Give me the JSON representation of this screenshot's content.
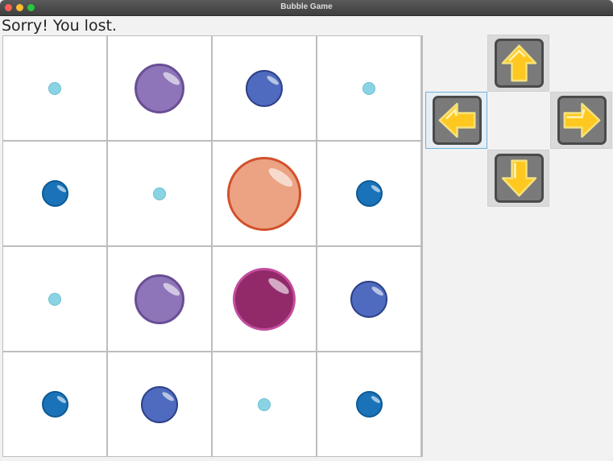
{
  "window": {
    "title": "Bubble Game"
  },
  "status": {
    "message": "Sorry! You lost."
  },
  "colors": {
    "light_blue": "#8ad3e3",
    "blue": "#1a73b8",
    "indigo": "#4f6bbf",
    "purple": "#8e74b8",
    "salmon": "#eba384",
    "magenta": "#922a6a",
    "arrow_yellow": "#ffc820"
  },
  "board": {
    "rows": 4,
    "cols": 4,
    "cells": [
      [
        {
          "color": "light_blue",
          "size": "tiny"
        },
        {
          "color": "purple",
          "size": "large"
        },
        {
          "color": "indigo",
          "size": "medium"
        },
        {
          "color": "light_blue",
          "size": "tiny"
        }
      ],
      [
        {
          "color": "blue",
          "size": "small"
        },
        {
          "color": "light_blue",
          "size": "tiny"
        },
        {
          "color": "salmon",
          "size": "huge"
        },
        {
          "color": "blue",
          "size": "small"
        }
      ],
      [
        {
          "color": "light_blue",
          "size": "tiny"
        },
        {
          "color": "purple",
          "size": "large"
        },
        {
          "color": "magenta",
          "size": "xlarge"
        },
        {
          "color": "indigo",
          "size": "medium"
        }
      ],
      [
        {
          "color": "blue",
          "size": "small"
        },
        {
          "color": "indigo",
          "size": "medium"
        },
        {
          "color": "light_blue",
          "size": "tiny"
        },
        {
          "color": "blue",
          "size": "small"
        }
      ]
    ]
  },
  "controls": [
    {
      "direction": "up",
      "icon": "arrow-up-icon"
    },
    {
      "direction": "left",
      "icon": "arrow-left-icon"
    },
    {
      "direction": "right",
      "icon": "arrow-right-icon"
    },
    {
      "direction": "down",
      "icon": "arrow-down-icon"
    }
  ]
}
